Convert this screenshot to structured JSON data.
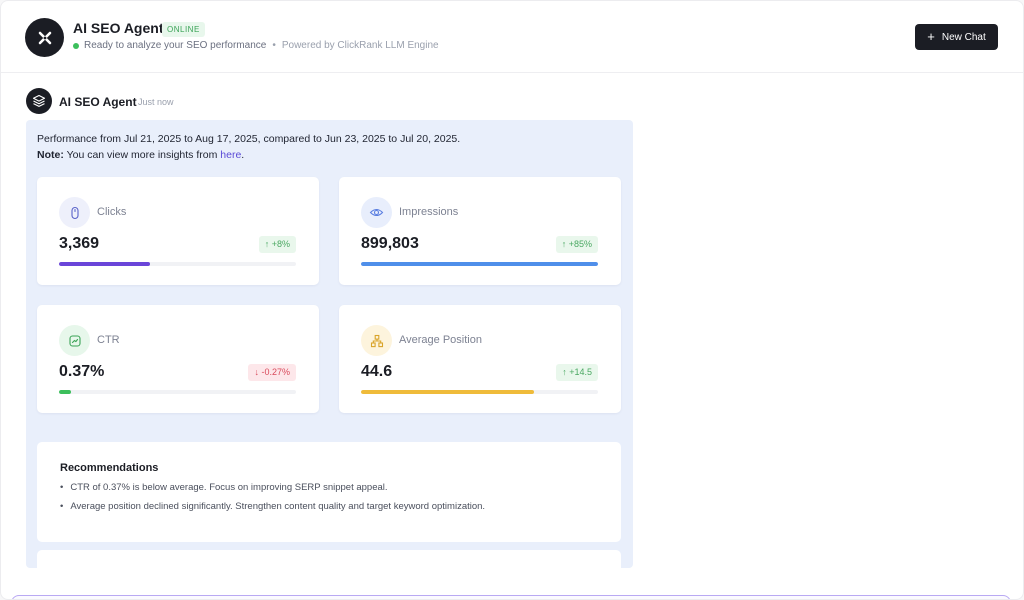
{
  "header": {
    "title": "AI SEO Agent",
    "badge": "ONLINE",
    "status": "Ready to analyze your SEO performance",
    "separator": "•",
    "powered_by": "Powered by ClickRank LLM Engine",
    "new_chat_label": "New Chat",
    "new_chat_icon": "plus-icon"
  },
  "message": {
    "sender": "AI SEO Agent",
    "time": "Just now",
    "performance_text": "Performance from Jul 21, 2025 to Aug 17, 2025, compared to Jun 23, 2025 to Jul 20, 2025.",
    "note_label": "Note:",
    "note_text": "You can view more insights from",
    "note_link": "here",
    "note_end": "."
  },
  "metrics": [
    {
      "label": "Clicks",
      "value": "3,369",
      "delta": "+8%",
      "direction": "up",
      "arrow": "↑",
      "progress": 0.385,
      "color": "#6a45d9",
      "icon": "mouse-icon",
      "icon_bg": "#eef0fb"
    },
    {
      "label": "Impressions",
      "value": "899,803",
      "delta": "+85%",
      "direction": "up",
      "arrow": "↑",
      "progress": 1.0,
      "color": "#4f8fea",
      "icon": "eye-icon",
      "icon_bg": "#e8eefc"
    },
    {
      "label": "CTR",
      "value": "0.37%",
      "delta": "-0.27%",
      "direction": "down",
      "arrow": "↓",
      "progress": 0.05,
      "color": "#3cbf5c",
      "icon": "chart-icon",
      "icon_bg": "#e7f7eb"
    },
    {
      "label": "Average Position",
      "value": "44.6",
      "delta": "+14.5",
      "direction": "up",
      "arrow": "↑",
      "progress": 0.73,
      "color": "#efbb3a",
      "icon": "hierarchy-icon",
      "icon_bg": "#fdf4dd"
    }
  ],
  "recommendations": {
    "title": "Recommendations",
    "bullet": "•",
    "items": [
      "CTR of 0.37% is below average. Focus on improving SERP snippet appeal.",
      "Average position declined significantly. Strengthen content quality and target keyword optimization."
    ]
  }
}
